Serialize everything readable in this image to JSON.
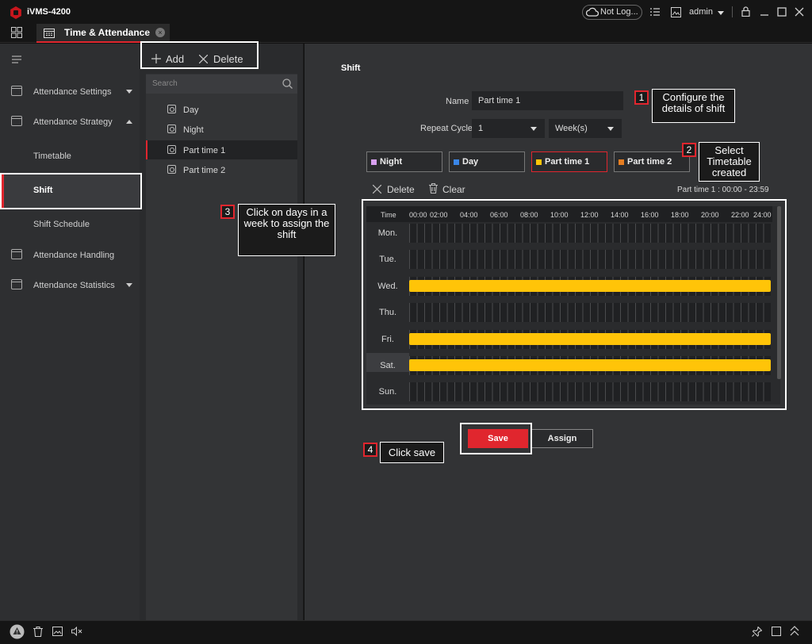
{
  "app": {
    "title": "iVMS-4200",
    "cloud_status": "Not Log...",
    "user": "admin"
  },
  "tab": {
    "label": "Time & Attendance"
  },
  "sidebar": {
    "items": [
      {
        "label": "Attendance Settings"
      },
      {
        "label": "Attendance Strategy"
      },
      {
        "label": "Timetable"
      },
      {
        "label": "Shift"
      },
      {
        "label": "Shift Schedule"
      },
      {
        "label": "Attendance Handling"
      },
      {
        "label": "Attendance Statistics"
      }
    ]
  },
  "list": {
    "add_label": "Add",
    "delete_label": "Delete",
    "search_placeholder": "Search",
    "items": [
      {
        "label": "Day"
      },
      {
        "label": "Night"
      },
      {
        "label": "Part time 1"
      },
      {
        "label": "Part time 2"
      }
    ]
  },
  "shift": {
    "title": "Shift",
    "name_label": "Name",
    "name_value": "Part time 1",
    "repeat_label": "Repeat Cycle",
    "repeat_value": "1",
    "repeat_unit": "Week(s)",
    "timetables": [
      {
        "label": "Night",
        "color": "#d8a0f0"
      },
      {
        "label": "Day",
        "color": "#3a86e8"
      },
      {
        "label": "Part time 1",
        "color": "#ffc408"
      },
      {
        "label": "Part time 2",
        "color": "#e67e22"
      }
    ],
    "delete_label": "Delete",
    "clear_label": "Clear",
    "selected_info": "Part time 1 : 00:00 - 23:59",
    "grid": {
      "time_header": "Time",
      "ticks": [
        "00:00",
        "02:00",
        "04:00",
        "06:00",
        "08:00",
        "10:00",
        "12:00",
        "14:00",
        "16:00",
        "18:00",
        "20:00",
        "22:00",
        "24:00"
      ],
      "days": [
        {
          "label": "Mon.",
          "assigned": false
        },
        {
          "label": "Tue.",
          "assigned": false
        },
        {
          "label": "Wed.",
          "assigned": true
        },
        {
          "label": "Thu.",
          "assigned": false
        },
        {
          "label": "Fri.",
          "assigned": true
        },
        {
          "label": "Sat.",
          "assigned": true
        },
        {
          "label": "Sun.",
          "assigned": false
        }
      ]
    },
    "save_label": "Save",
    "assign_label": "Assign"
  },
  "annotations": [
    {
      "num": "1",
      "text": "Configure the details of shift"
    },
    {
      "num": "2",
      "text": "Select Timetable created"
    },
    {
      "num": "3",
      "text": "Click on days in a week to assign the shift"
    },
    {
      "num": "4",
      "text": "Click save"
    }
  ],
  "accent_color": "#e0262e"
}
